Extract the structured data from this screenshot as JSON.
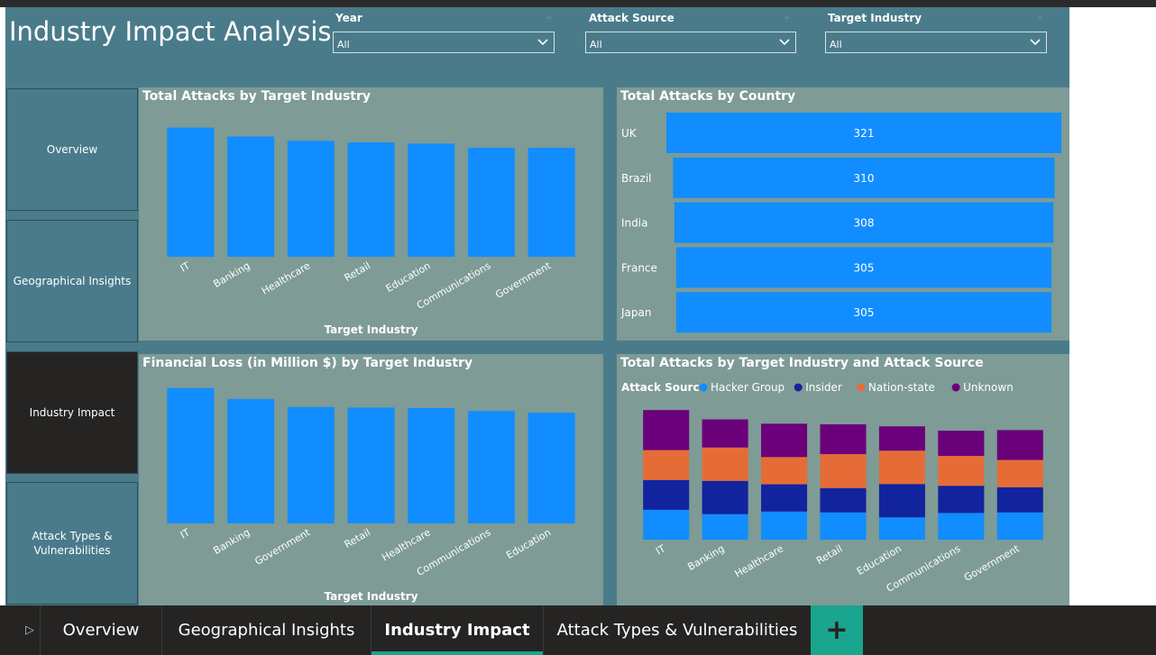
{
  "colors": {
    "accent": "#118dff",
    "canvas": "#4a7b8a",
    "panel": "#7e9b95",
    "active_nav": "#252423",
    "tab_accent": "#1aa58e"
  },
  "page_title": "Industry Impact Analysis",
  "slicers": [
    {
      "label": "Year",
      "value": "All"
    },
    {
      "label": "Attack Source",
      "value": "All"
    },
    {
      "label": "Target Industry",
      "value": "All"
    }
  ],
  "nav": {
    "items": [
      {
        "label": "Overview"
      },
      {
        "label": "Geographical Insights"
      },
      {
        "label": "Industry Impact",
        "active": true
      },
      {
        "label": "Attack Types & Vulnerabilities"
      }
    ]
  },
  "tabs": {
    "prev_icon": "chevron-right-icon",
    "add_label": "+",
    "items": [
      {
        "label": "Overview"
      },
      {
        "label": "Geographical Insights"
      },
      {
        "label": "Industry Impact",
        "active": true
      },
      {
        "label": "Attack Types & Vulnerabilities"
      }
    ]
  },
  "chart_data": [
    {
      "type": "bar",
      "title": "Total Attacks by Target Industry",
      "xlabel": "Target Industry",
      "ylabel": "",
      "categories": [
        "IT",
        "Banking",
        "Healthcare",
        "Retail",
        "Education",
        "Communications",
        "Government"
      ],
      "values": [
        478,
        445,
        429,
        423,
        419,
        403,
        403
      ],
      "ylim": [
        0,
        500
      ],
      "color": "#118dff",
      "grid": false
    },
    {
      "type": "bar",
      "orientation": "horizontal",
      "title": "Total Attacks by Country",
      "categories": [
        "UK",
        "Brazil",
        "India",
        "France",
        "Japan"
      ],
      "values": [
        321,
        310,
        308,
        305,
        305
      ],
      "data_labels": true,
      "color": "#118dff"
    },
    {
      "type": "bar",
      "title": "Financial Loss (in Million $) by Target Industry",
      "xlabel": "Target Industry",
      "ylabel": "",
      "categories": [
        "IT",
        "Banking",
        "Government",
        "Retail",
        "Healthcare",
        "Communications",
        "Education"
      ],
      "values": [
        23.6,
        21.7,
        20.3,
        20.2,
        20.1,
        19.6,
        19.3
      ],
      "ylim": [
        0,
        24.5
      ],
      "color": "#118dff",
      "grid": false
    },
    {
      "type": "bar",
      "stacked": true,
      "title": "Total Attacks by Target Industry and Attack Source",
      "legend_title": "Attack Source",
      "legend_position": "top-left",
      "categories": [
        "IT",
        "Banking",
        "Healthcare",
        "Retail",
        "Education",
        "Communications",
        "Government"
      ],
      "series": [
        {
          "name": "Hacker Group",
          "color": "#118dff",
          "values": [
            103,
            88,
            97,
            94,
            77,
            92,
            94
          ]
        },
        {
          "name": "Insider",
          "color": "#12239e",
          "values": [
            103,
            115,
            94,
            84,
            115,
            94,
            87
          ]
        },
        {
          "name": "Nation-state",
          "color": "#e66c37",
          "values": [
            103,
            115,
            94,
            117,
            115,
            103,
            94
          ]
        },
        {
          "name": "Unknown",
          "color": "#6b007b",
          "values": [
            138,
            97,
            115,
            103,
            84,
            87,
            103
          ]
        }
      ],
      "ylim": [
        0,
        460
      ]
    }
  ]
}
